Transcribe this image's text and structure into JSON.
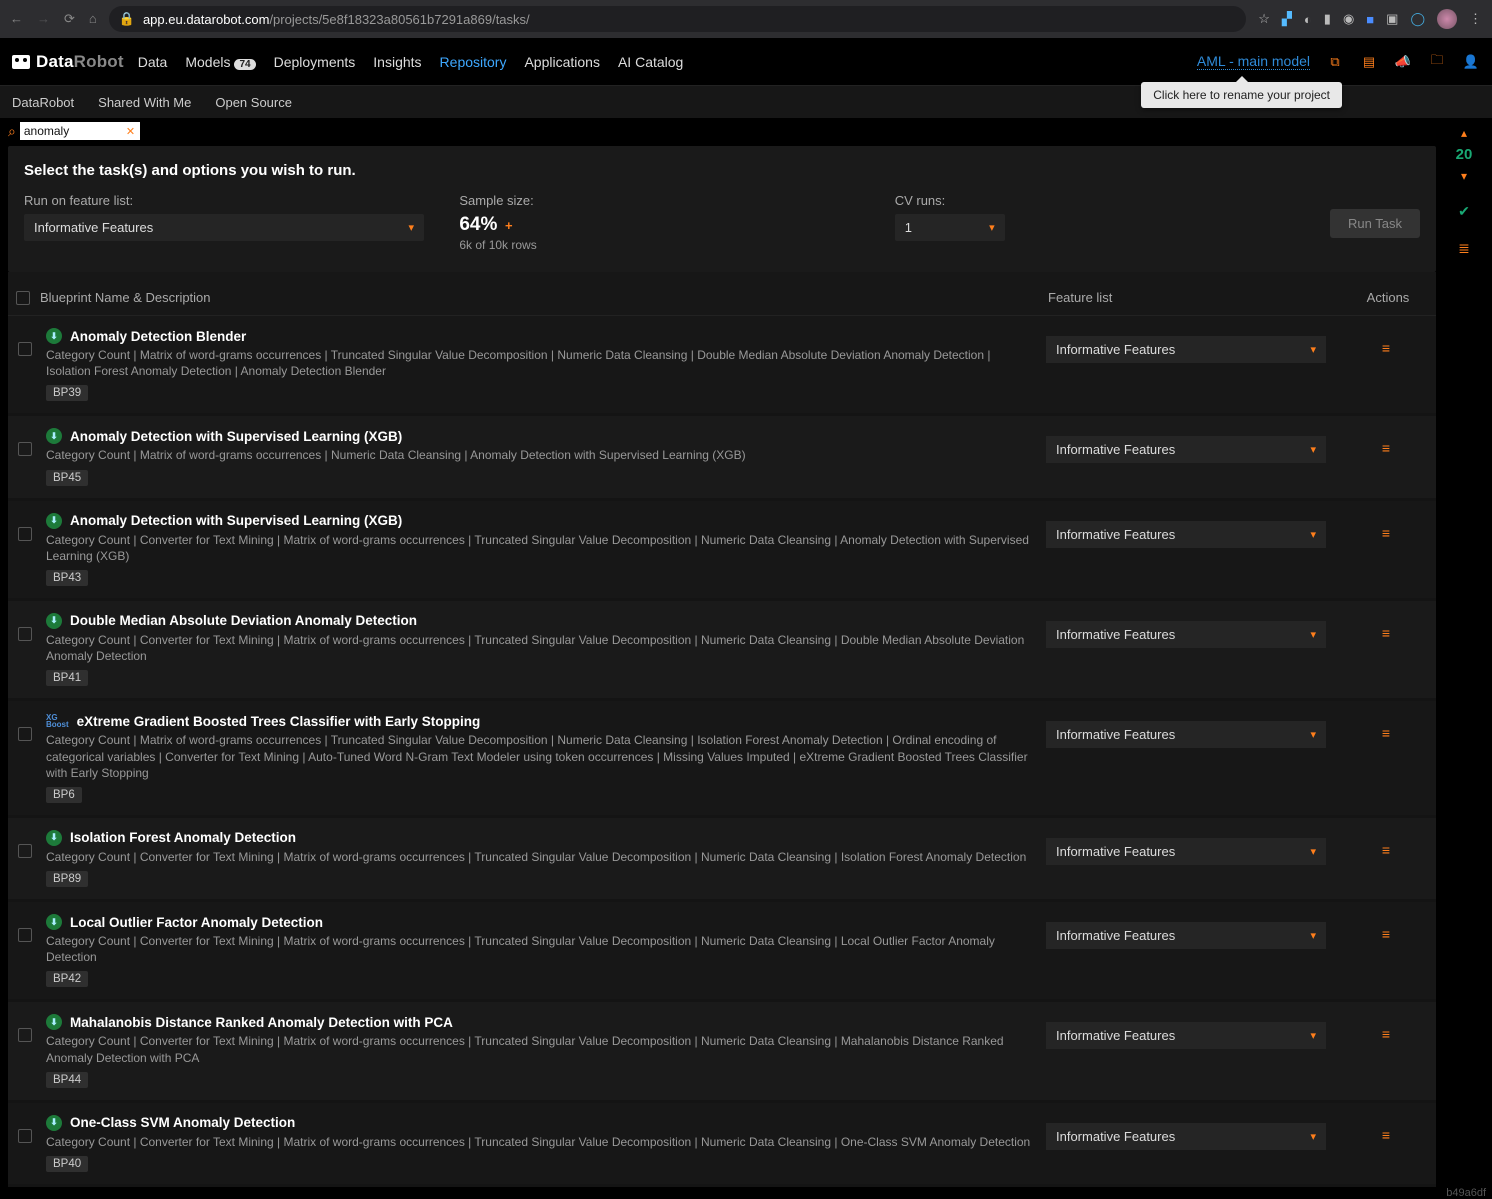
{
  "browser": {
    "url_domain": "app.eu.datarobot.com",
    "url_path": "/projects/5e8f18323a80561b7291a869/tasks/"
  },
  "topnav": {
    "logo_data": "Data",
    "logo_robot": "Robot",
    "items": [
      "Data",
      "Models",
      "Deployments",
      "Insights",
      "Repository",
      "Applications",
      "AI Catalog"
    ],
    "models_badge": "74",
    "active_index": 4,
    "project_name": "AML - main model",
    "tooltip": "Click here to rename your project"
  },
  "subtabs": [
    "DataRobot",
    "Shared With Me",
    "Open Source"
  ],
  "search": {
    "value": "anomaly"
  },
  "options": {
    "title": "Select the task(s) and options you wish to run.",
    "feature_list_label": "Run on feature list:",
    "feature_list_value": "Informative Features",
    "sample_label": "Sample size:",
    "sample_pct": "64%",
    "sample_sub": "6k of 10k rows",
    "cv_label": "CV runs:",
    "cv_value": "1",
    "run_btn": "Run Task"
  },
  "columns": {
    "name": "Blueprint Name & Description",
    "fl": "Feature list",
    "act": "Actions"
  },
  "feature_list_default": "Informative Features",
  "rightrail": {
    "count": "20"
  },
  "footer_hash": "b49a6df",
  "rows": [
    {
      "title": "Anomaly Detection Blender",
      "desc": "Category Count | Matrix of word-grams occurrences | Truncated Singular Value Decomposition | Numeric Data Cleansing | Double Median Absolute Deviation Anomaly Detection | Isolation Forest Anomaly Detection | Anomaly Detection Blender",
      "bp": "BP39",
      "badge": "std"
    },
    {
      "title": "Anomaly Detection with Supervised Learning (XGB)",
      "desc": "Category Count | Matrix of word-grams occurrences | Numeric Data Cleansing | Anomaly Detection with Supervised Learning (XGB)",
      "bp": "BP45",
      "badge": "std"
    },
    {
      "title": "Anomaly Detection with Supervised Learning (XGB)",
      "desc": "Category Count | Converter for Text Mining | Matrix of word-grams occurrences | Truncated Singular Value Decomposition | Numeric Data Cleansing | Anomaly Detection with Supervised Learning (XGB)",
      "bp": "BP43",
      "badge": "std"
    },
    {
      "title": "Double Median Absolute Deviation Anomaly Detection",
      "desc": "Category Count | Converter for Text Mining | Matrix of word-grams occurrences | Truncated Singular Value Decomposition | Numeric Data Cleansing | Double Median Absolute Deviation Anomaly Detection",
      "bp": "BP41",
      "badge": "std"
    },
    {
      "title": "eXtreme Gradient Boosted Trees Classifier with Early Stopping",
      "desc": "Category Count | Matrix of word-grams occurrences | Truncated Singular Value Decomposition | Numeric Data Cleansing | Isolation Forest Anomaly Detection | Ordinal encoding of categorical variables | Converter for Text Mining | Auto-Tuned Word N-Gram Text Modeler using token occurrences | Missing Values Imputed | eXtreme Gradient Boosted Trees Classifier with Early Stopping",
      "bp": "BP6",
      "badge": "xg"
    },
    {
      "title": "Isolation Forest Anomaly Detection",
      "desc": "Category Count | Converter for Text Mining | Matrix of word-grams occurrences | Truncated Singular Value Decomposition | Numeric Data Cleansing | Isolation Forest Anomaly Detection",
      "bp": "BP89",
      "badge": "std"
    },
    {
      "title": "Local Outlier Factor Anomaly Detection",
      "desc": "Category Count | Converter for Text Mining | Matrix of word-grams occurrences | Truncated Singular Value Decomposition | Numeric Data Cleansing | Local Outlier Factor Anomaly Detection",
      "bp": "BP42",
      "badge": "std"
    },
    {
      "title": "Mahalanobis Distance Ranked Anomaly Detection with PCA",
      "desc": "Category Count | Converter for Text Mining | Matrix of word-grams occurrences | Truncated Singular Value Decomposition | Numeric Data Cleansing | Mahalanobis Distance Ranked Anomaly Detection with PCA",
      "bp": "BP44",
      "badge": "std"
    },
    {
      "title": "One-Class SVM Anomaly Detection",
      "desc": "Category Count | Converter for Text Mining | Matrix of word-grams occurrences | Truncated Singular Value Decomposition | Numeric Data Cleansing | One-Class SVM Anomaly Detection",
      "bp": "BP40",
      "badge": "std"
    }
  ]
}
